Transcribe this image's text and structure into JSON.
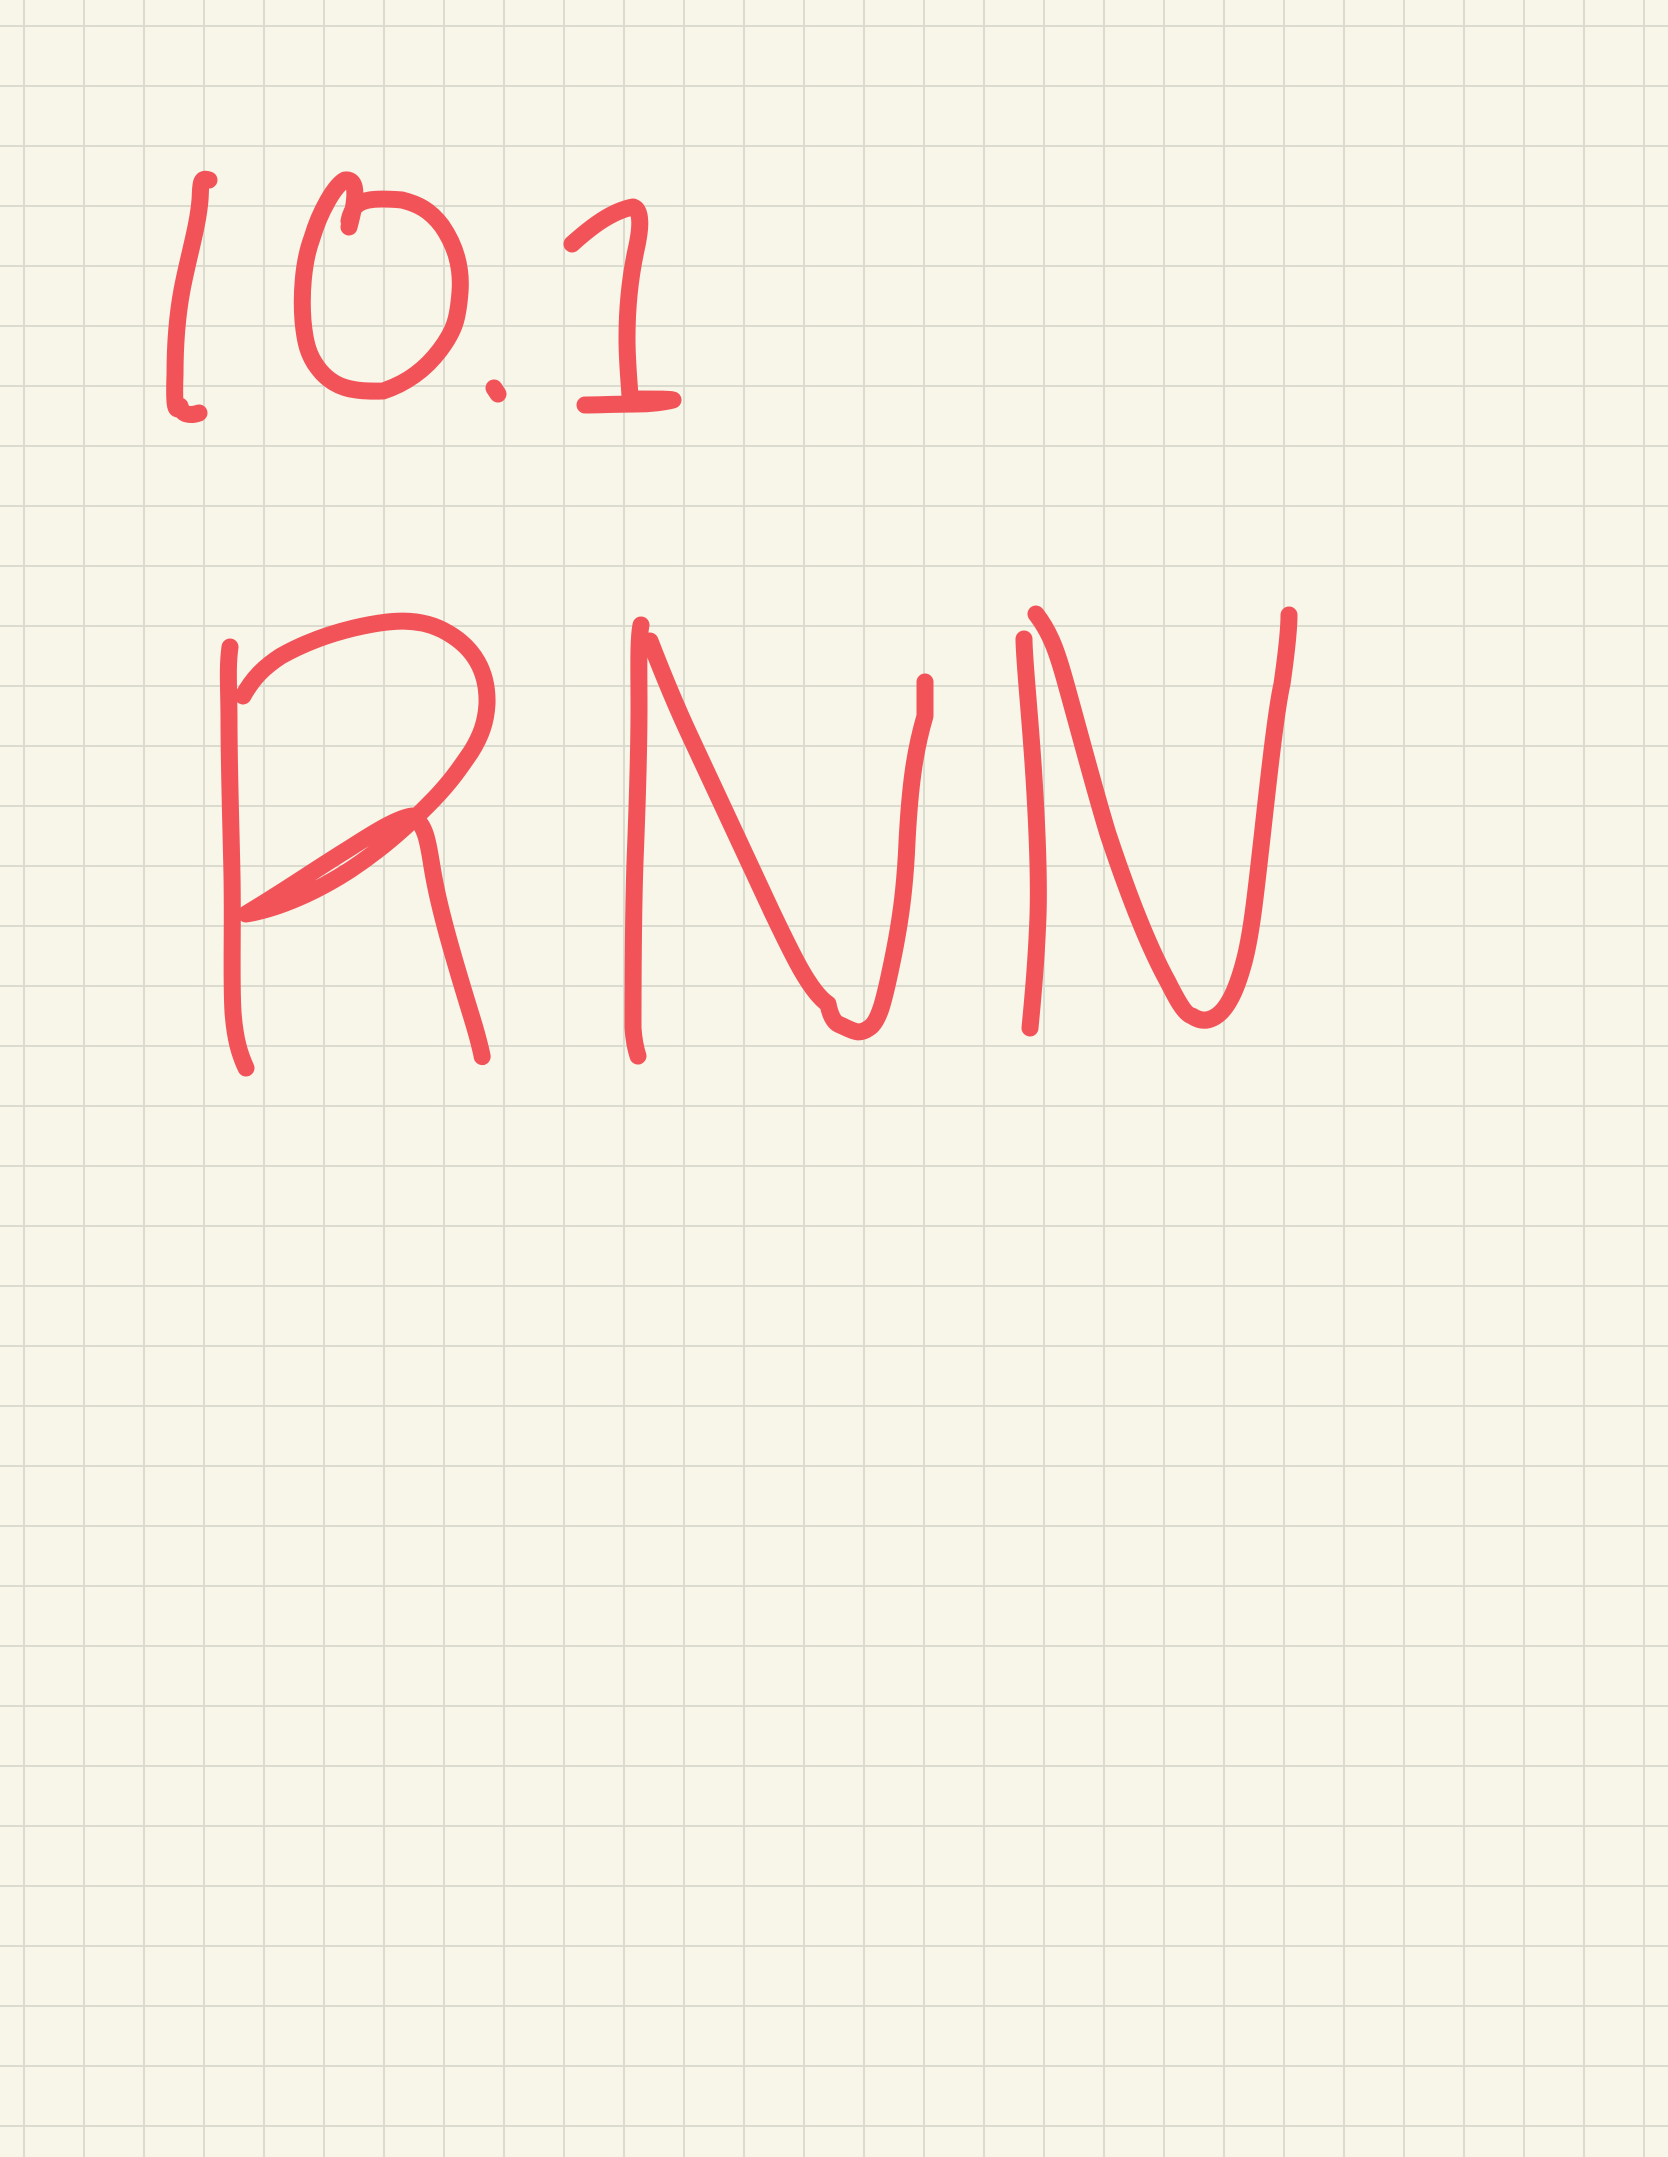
{
  "page": {
    "background_color": "#f8f5e9",
    "grid_color": "#dcdbd0",
    "ink_color": "#f25358"
  },
  "note": {
    "section_number": "10.1",
    "heading": "RNN"
  }
}
